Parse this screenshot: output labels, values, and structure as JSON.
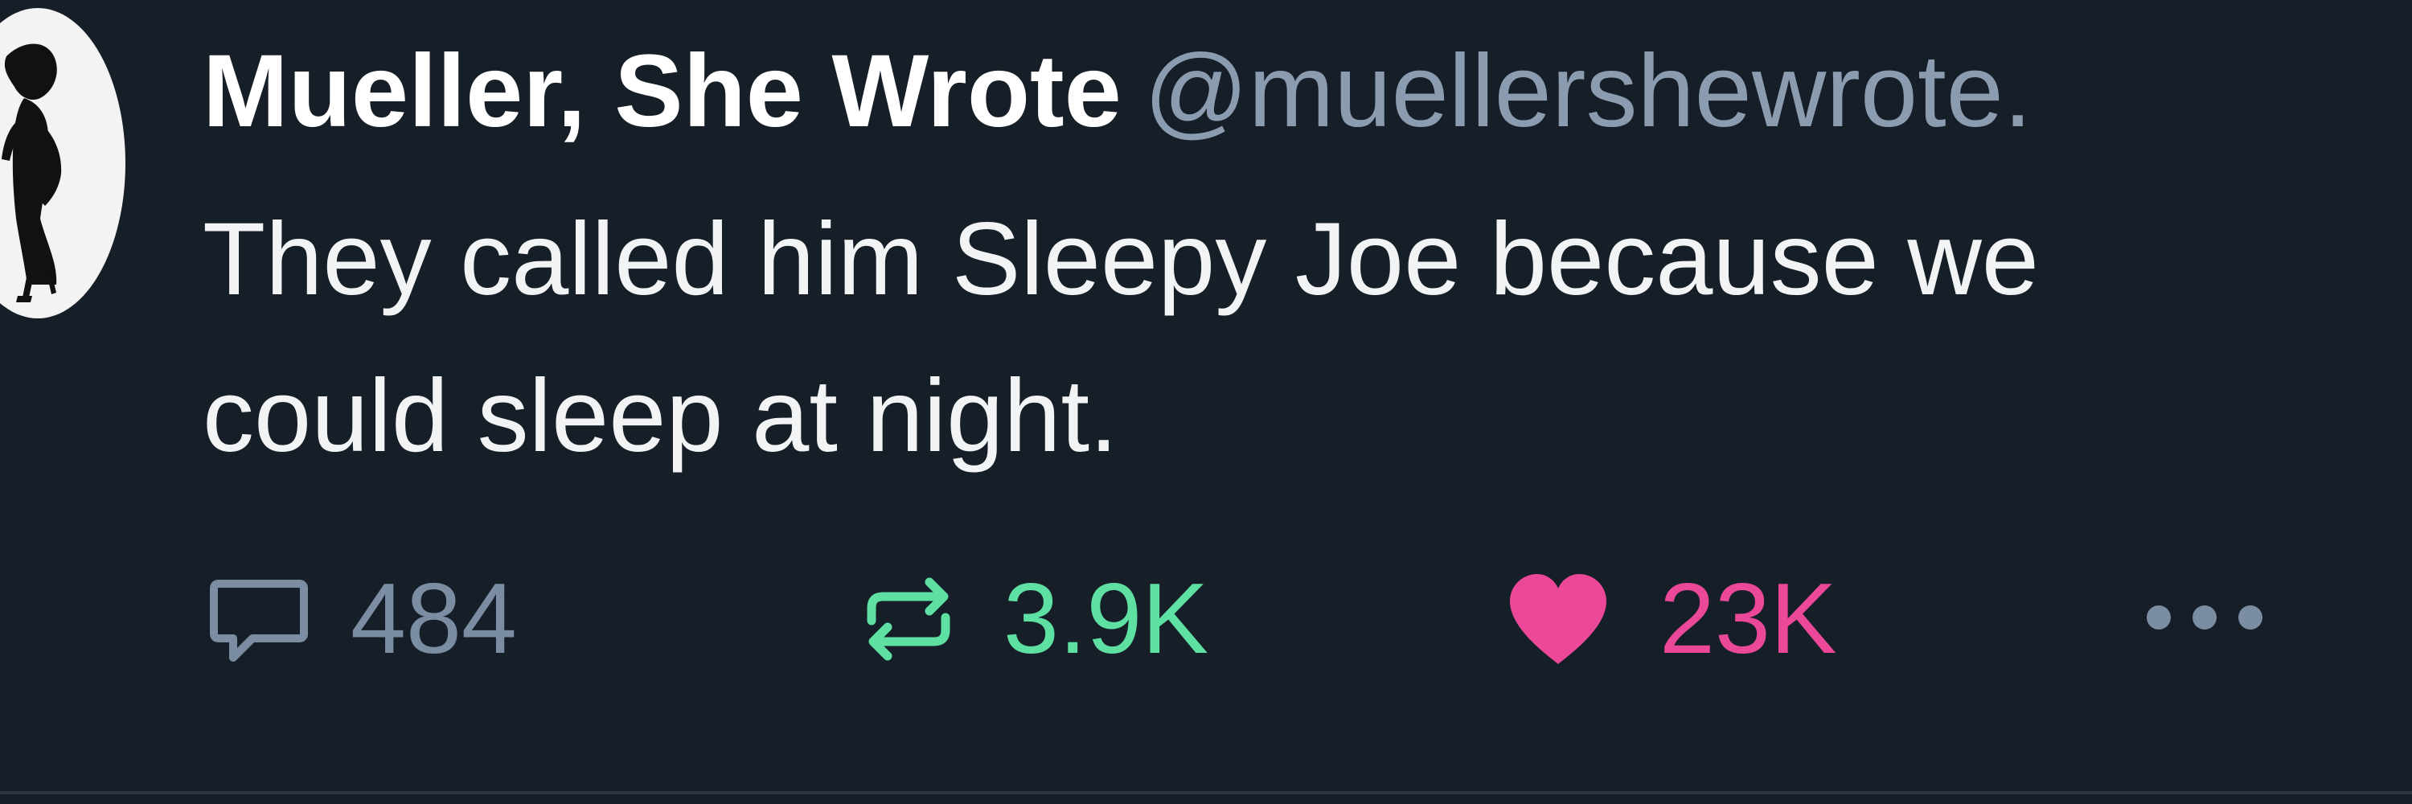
{
  "post": {
    "author": {
      "display_name": "Mueller, She Wrote",
      "handle": "@muellershewrote.",
      "avatar_icon": "silhouette-woman-avatar"
    },
    "text_lines": [
      "They called him Sleepy Joe because we",
      "could sleep at night."
    ],
    "actions": {
      "reply": {
        "icon": "speech-bubble-icon",
        "count": "484"
      },
      "repost": {
        "icon": "repost-arrows-icon",
        "count": "3.9K"
      },
      "like": {
        "icon": "heart-icon",
        "count": "23K",
        "liked": true
      },
      "more": {
        "icon": "more-dots-icon"
      }
    }
  },
  "colors": {
    "background": "#161e27",
    "display_name": "#ffffff",
    "handle": "#8b9cb1",
    "body_text": "#f1f3f5",
    "reply": "#7b8da3",
    "repost": "#5ee0a3",
    "like": "#ec4899",
    "divider": "#2b3542"
  }
}
